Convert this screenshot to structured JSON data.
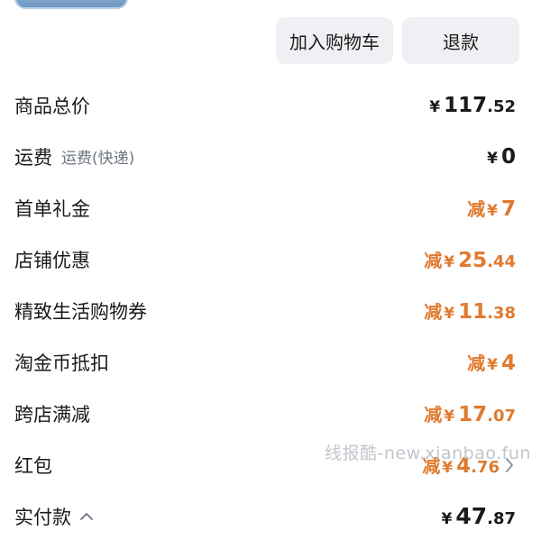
{
  "actions": {
    "add_to_cart": "加入购物车",
    "refund": "退款"
  },
  "summary": {
    "subtotal": {
      "label": "商品总价",
      "yen": "¥",
      "int": "117",
      "dec": ".52"
    },
    "shipping": {
      "label": "运费",
      "sublabel": "运费(快递)",
      "yen": "¥",
      "int": "0",
      "dec": ""
    },
    "first_order_gift": {
      "label": "首单礼金",
      "minus": "减",
      "yen": "¥",
      "int": "7",
      "dec": ""
    },
    "store_discount": {
      "label": "店铺优惠",
      "minus": "减",
      "yen": "¥",
      "int": "25",
      "dec": ".44"
    },
    "lifestyle_coupon": {
      "label": "精致生活购物券",
      "minus": "减",
      "yen": "¥",
      "int": "11",
      "dec": ".38"
    },
    "taojinbi": {
      "label": "淘金币抵扣",
      "minus": "减",
      "yen": "¥",
      "int": "4",
      "dec": ""
    },
    "cross_store": {
      "label": "跨店满减",
      "minus": "减",
      "yen": "¥",
      "int": "17",
      "dec": ".07"
    },
    "red_packet": {
      "label": "红包",
      "minus": "减",
      "yen": "¥",
      "int": "4",
      "dec": ".76"
    },
    "paid": {
      "label": "实付款",
      "yen": "¥",
      "int": "47",
      "dec": ".87"
    }
  },
  "watermark": "线报酷-new.xianbao.fun",
  "colors": {
    "discount": "#e07a2f",
    "text": "#1a1a1a",
    "muted": "#6d7480",
    "button_bg": "#eef0f3"
  },
  "icons": {
    "paid_toggle": "chevron-up-icon",
    "red_packet_more": "chevron-right-icon"
  }
}
